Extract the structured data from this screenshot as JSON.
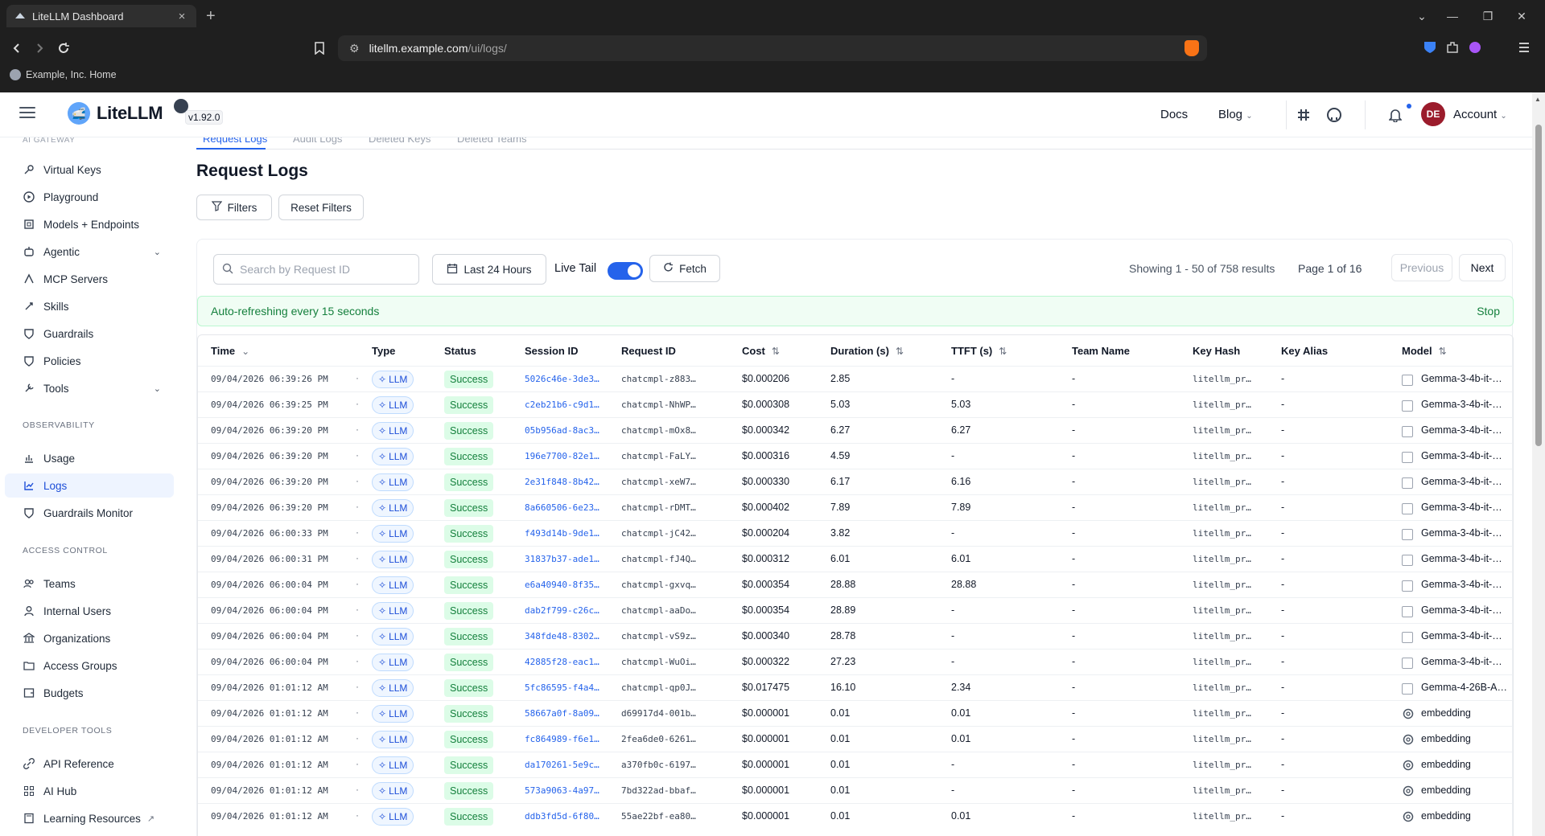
{
  "browser": {
    "tab_title": "LiteLLM Dashboard",
    "url_domain": "litellm.example.com",
    "url_path": "/ui/logs/",
    "bookmark": "Example, Inc. Home"
  },
  "header": {
    "logo_text": "LiteLLM",
    "version": "v1.92.0",
    "docs": "Docs",
    "blog": "Blog",
    "avatar_initials": "DE",
    "account": "Account"
  },
  "sidebar": {
    "cut_section": "AI GATEWAY",
    "items": [
      {
        "label": "Virtual Keys",
        "icon": "key-icon"
      },
      {
        "label": "Playground",
        "icon": "play-icon"
      },
      {
        "label": "Models + Endpoints",
        "icon": "cube-icon"
      },
      {
        "label": "Agentic",
        "icon": "robot-icon"
      },
      {
        "label": "MCP Servers",
        "icon": "server-icon"
      },
      {
        "label": "Skills",
        "icon": "rocket-icon"
      },
      {
        "label": "Guardrails",
        "icon": "shield-icon"
      },
      {
        "label": "Policies",
        "icon": "shield-icon"
      },
      {
        "label": "Tools",
        "icon": "wrench-icon"
      }
    ],
    "section_observability": "OBSERVABILITY",
    "obs_items": [
      {
        "label": "Usage",
        "icon": "chart-icon"
      },
      {
        "label": "Logs",
        "icon": "line-chart-icon"
      },
      {
        "label": "Guardrails Monitor",
        "icon": "shield-icon"
      }
    ],
    "section_access": "ACCESS CONTROL",
    "access_items": [
      {
        "label": "Teams",
        "icon": "team-icon"
      },
      {
        "label": "Internal Users",
        "icon": "user-icon"
      },
      {
        "label": "Organizations",
        "icon": "bank-icon"
      },
      {
        "label": "Access Groups",
        "icon": "folder-icon"
      },
      {
        "label": "Budgets",
        "icon": "wallet-icon"
      }
    ],
    "section_dev": "DEVELOPER TOOLS",
    "dev_items": [
      {
        "label": "API Reference",
        "icon": "link-icon"
      },
      {
        "label": "AI Hub",
        "icon": "grid-icon"
      },
      {
        "label": "Learning Resources",
        "icon": "book-icon"
      }
    ]
  },
  "main": {
    "subtabs": [
      "Request Logs",
      "Audit Logs",
      "Deleted Keys",
      "Deleted Teams"
    ],
    "title": "Request Logs",
    "filters_btn": "Filters",
    "reset_btn": "Reset Filters",
    "search_placeholder": "Search by Request ID",
    "time_range": "Last 24 Hours",
    "live_tail": "Live Tail",
    "fetch": "Fetch",
    "showing": "Showing 1 - 50 of 758 results",
    "page": "Page 1 of 16",
    "previous": "Previous",
    "next": "Next",
    "banner": "Auto-refreshing every 15 seconds",
    "stop": "Stop"
  },
  "table": {
    "columns": [
      "Time",
      "Type",
      "Status",
      "Session ID",
      "Request ID",
      "Cost",
      "Duration (s)",
      "TTFT (s)",
      "Team Name",
      "Key Hash",
      "Key Alias",
      "Model"
    ],
    "rows": [
      {
        "time": "09/04/2026 06:39:26 PM",
        "type": "LLM",
        "status": "Success",
        "session": "5026c46e-3de3…",
        "request": "chatcmpl-z883…",
        "cost": "$0.000206",
        "duration": "2.85",
        "ttft": "-",
        "team": "-",
        "keyhash": "litellm_pr…",
        "alias": "-",
        "model": "Gemma-3-4b-it-…",
        "model_icon": "checkbox"
      },
      {
        "time": "09/04/2026 06:39:25 PM",
        "type": "LLM",
        "status": "Success",
        "session": "c2eb21b6-c9d1…",
        "request": "chatcmpl-NhWP…",
        "cost": "$0.000308",
        "duration": "5.03",
        "ttft": "5.03",
        "team": "-",
        "keyhash": "litellm_pr…",
        "alias": "-",
        "model": "Gemma-3-4b-it-…",
        "model_icon": "checkbox"
      },
      {
        "time": "09/04/2026 06:39:20 PM",
        "type": "LLM",
        "status": "Success",
        "session": "05b956ad-8ac3…",
        "request": "chatcmpl-mOx8…",
        "cost": "$0.000342",
        "duration": "6.27",
        "ttft": "6.27",
        "team": "-",
        "keyhash": "litellm_pr…",
        "alias": "-",
        "model": "Gemma-3-4b-it-…",
        "model_icon": "checkbox"
      },
      {
        "time": "09/04/2026 06:39:20 PM",
        "type": "LLM",
        "status": "Success",
        "session": "196e7700-82e1…",
        "request": "chatcmpl-FaLY…",
        "cost": "$0.000316",
        "duration": "4.59",
        "ttft": "-",
        "team": "-",
        "keyhash": "litellm_pr…",
        "alias": "-",
        "model": "Gemma-3-4b-it-…",
        "model_icon": "checkbox"
      },
      {
        "time": "09/04/2026 06:39:20 PM",
        "type": "LLM",
        "status": "Success",
        "session": "2e31f848-8b42…",
        "request": "chatcmpl-xeW7…",
        "cost": "$0.000330",
        "duration": "6.17",
        "ttft": "6.16",
        "team": "-",
        "keyhash": "litellm_pr…",
        "alias": "-",
        "model": "Gemma-3-4b-it-…",
        "model_icon": "checkbox"
      },
      {
        "time": "09/04/2026 06:39:20 PM",
        "type": "LLM",
        "status": "Success",
        "session": "8a660506-6e23…",
        "request": "chatcmpl-rDMT…",
        "cost": "$0.000402",
        "duration": "7.89",
        "ttft": "7.89",
        "team": "-",
        "keyhash": "litellm_pr…",
        "alias": "-",
        "model": "Gemma-3-4b-it-…",
        "model_icon": "checkbox"
      },
      {
        "time": "09/04/2026 06:00:33 PM",
        "type": "LLM",
        "status": "Success",
        "session": "f493d14b-9de1…",
        "request": "chatcmpl-jC42…",
        "cost": "$0.000204",
        "duration": "3.82",
        "ttft": "-",
        "team": "-",
        "keyhash": "litellm_pr…",
        "alias": "-",
        "model": "Gemma-3-4b-it-…",
        "model_icon": "checkbox"
      },
      {
        "time": "09/04/2026 06:00:31 PM",
        "type": "LLM",
        "status": "Success",
        "session": "31837b37-ade1…",
        "request": "chatcmpl-fJ4Q…",
        "cost": "$0.000312",
        "duration": "6.01",
        "ttft": "6.01",
        "team": "-",
        "keyhash": "litellm_pr…",
        "alias": "-",
        "model": "Gemma-3-4b-it-…",
        "model_icon": "checkbox"
      },
      {
        "time": "09/04/2026 06:00:04 PM",
        "type": "LLM",
        "status": "Success",
        "session": "e6a40940-8f35…",
        "request": "chatcmpl-gxvq…",
        "cost": "$0.000354",
        "duration": "28.88",
        "ttft": "28.88",
        "team": "-",
        "keyhash": "litellm_pr…",
        "alias": "-",
        "model": "Gemma-3-4b-it-…",
        "model_icon": "checkbox"
      },
      {
        "time": "09/04/2026 06:00:04 PM",
        "type": "LLM",
        "status": "Success",
        "session": "dab2f799-c26c…",
        "request": "chatcmpl-aaDo…",
        "cost": "$0.000354",
        "duration": "28.89",
        "ttft": "-",
        "team": "-",
        "keyhash": "litellm_pr…",
        "alias": "-",
        "model": "Gemma-3-4b-it-…",
        "model_icon": "checkbox"
      },
      {
        "time": "09/04/2026 06:00:04 PM",
        "type": "LLM",
        "status": "Success",
        "session": "348fde48-8302…",
        "request": "chatcmpl-vS9z…",
        "cost": "$0.000340",
        "duration": "28.78",
        "ttft": "-",
        "team": "-",
        "keyhash": "litellm_pr…",
        "alias": "-",
        "model": "Gemma-3-4b-it-…",
        "model_icon": "checkbox"
      },
      {
        "time": "09/04/2026 06:00:04 PM",
        "type": "LLM",
        "status": "Success",
        "session": "42885f28-eac1…",
        "request": "chatcmpl-WuOi…",
        "cost": "$0.000322",
        "duration": "27.23",
        "ttft": "-",
        "team": "-",
        "keyhash": "litellm_pr…",
        "alias": "-",
        "model": "Gemma-3-4b-it-…",
        "model_icon": "checkbox"
      },
      {
        "time": "09/04/2026 01:01:12 AM",
        "type": "LLM",
        "status": "Success",
        "session": "5fc86595-f4a4…",
        "request": "chatcmpl-qp0J…",
        "cost": "$0.017475",
        "duration": "16.10",
        "ttft": "2.34",
        "team": "-",
        "keyhash": "litellm_pr…",
        "alias": "-",
        "model": "Gemma-4-26B-A…",
        "model_icon": "checkbox"
      },
      {
        "time": "09/04/2026 01:01:12 AM",
        "type": "LLM",
        "status": "Success",
        "session": "58667a0f-8a09…",
        "request": "d69917d4-001b…",
        "cost": "$0.000001",
        "duration": "0.01",
        "ttft": "0.01",
        "team": "-",
        "keyhash": "litellm_pr…",
        "alias": "-",
        "model": "embedding",
        "model_icon": "openai"
      },
      {
        "time": "09/04/2026 01:01:12 AM",
        "type": "LLM",
        "status": "Success",
        "session": "fc864989-f6e1…",
        "request": "2fea6de0-6261…",
        "cost": "$0.000001",
        "duration": "0.01",
        "ttft": "0.01",
        "team": "-",
        "keyhash": "litellm_pr…",
        "alias": "-",
        "model": "embedding",
        "model_icon": "openai"
      },
      {
        "time": "09/04/2026 01:01:12 AM",
        "type": "LLM",
        "status": "Success",
        "session": "da170261-5e9c…",
        "request": "a370fb0c-6197…",
        "cost": "$0.000001",
        "duration": "0.01",
        "ttft": "-",
        "team": "-",
        "keyhash": "litellm_pr…",
        "alias": "-",
        "model": "embedding",
        "model_icon": "openai"
      },
      {
        "time": "09/04/2026 01:01:12 AM",
        "type": "LLM",
        "status": "Success",
        "session": "573a9063-4a97…",
        "request": "7bd322ad-bbaf…",
        "cost": "$0.000001",
        "duration": "0.01",
        "ttft": "-",
        "team": "-",
        "keyhash": "litellm_pr…",
        "alias": "-",
        "model": "embedding",
        "model_icon": "openai"
      },
      {
        "time": "09/04/2026 01:01:12 AM",
        "type": "LLM",
        "status": "Success",
        "session": "ddb3fd5d-6f80…",
        "request": "55ae22bf-ea80…",
        "cost": "$0.000001",
        "duration": "0.01",
        "ttft": "0.01",
        "team": "-",
        "keyhash": "litellm_pr…",
        "alias": "-",
        "model": "embedding",
        "model_icon": "openai"
      }
    ]
  },
  "colors": {
    "accent": "#2563eb",
    "success_bg": "#dcfce7",
    "success_text": "#15803d",
    "avatar": "#9b1c2c"
  }
}
